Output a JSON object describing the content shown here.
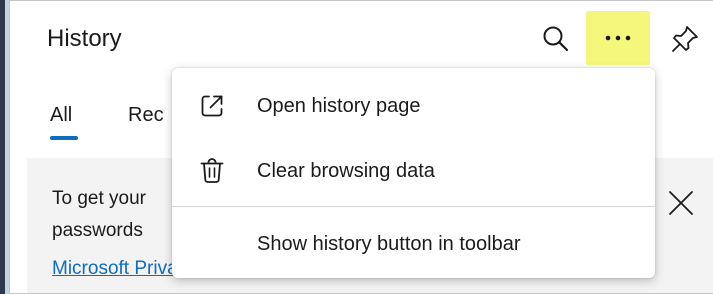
{
  "header": {
    "title": "History",
    "icons": {
      "search": "search-icon",
      "more": "more-options-icon",
      "pin": "pin-icon"
    },
    "more_highlight_color": "#f5f77c"
  },
  "tabs": [
    {
      "label": "All",
      "selected": true
    },
    {
      "label": "Recently closed",
      "selected": false
    }
  ],
  "notice": {
    "line1": "To get your",
    "line2": "passwords",
    "link": "Microsoft Privacy Statement",
    "close_icon": "close-icon"
  },
  "menu": {
    "items": [
      {
        "label": "Open history page",
        "icon": "open-external-icon"
      },
      {
        "label": "Clear browsing data",
        "icon": "trash-icon"
      },
      {
        "label": "Show history button in toolbar"
      }
    ]
  },
  "colors": {
    "accent": "#0f6cbd",
    "notice_bg": "#f3f3f3"
  }
}
